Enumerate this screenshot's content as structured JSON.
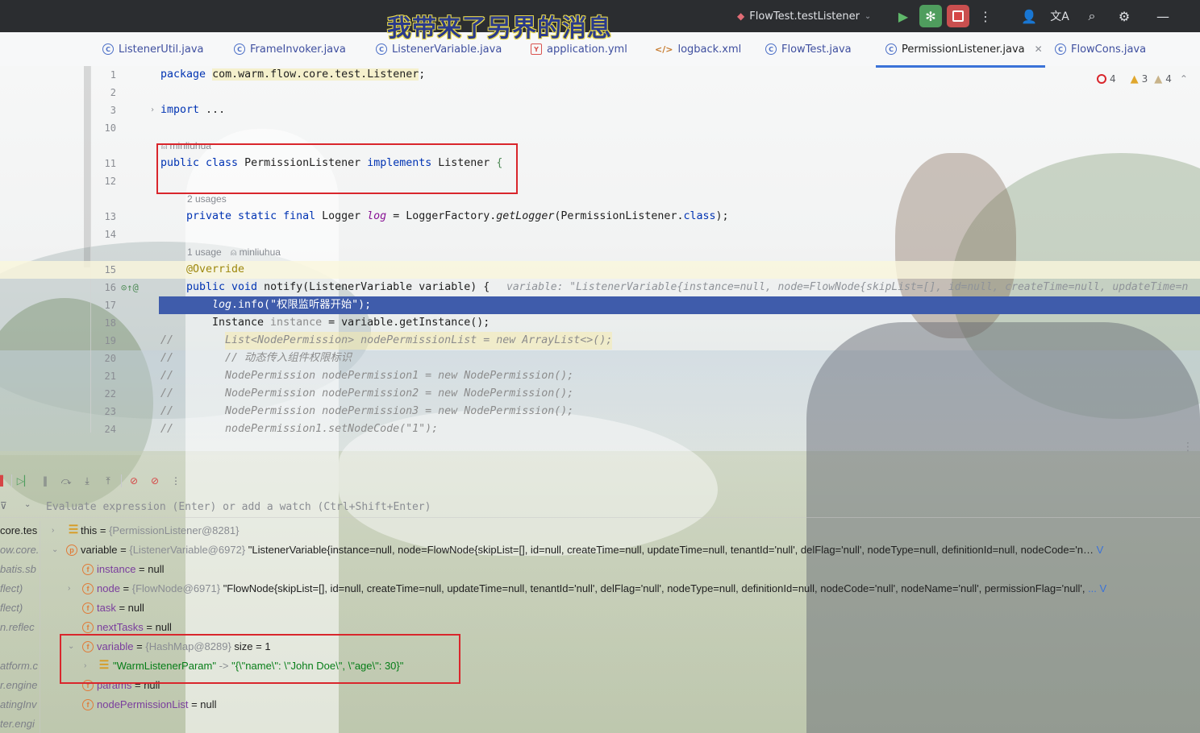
{
  "overlay_caption": "我带来了另界的消息",
  "titlebar": {
    "run_config": "FlowTest.testListener"
  },
  "tabs": [
    {
      "label": "ListenerUtil.java",
      "icon": "java-class-icon"
    },
    {
      "label": "FrameInvoker.java",
      "icon": "java-class-icon"
    },
    {
      "label": "ListenerVariable.java",
      "icon": "java-class-icon"
    },
    {
      "label": "application.yml",
      "icon": "yaml-file-icon"
    },
    {
      "label": "logback.xml",
      "icon": "xml-file-icon"
    },
    {
      "label": "FlowTest.java",
      "icon": "java-class-icon"
    },
    {
      "label": "PermissionListener.java",
      "icon": "java-class-icon",
      "active": true
    },
    {
      "label": "FlowCons.java",
      "icon": "java-class-icon"
    }
  ],
  "problems": {
    "errors": "4",
    "warnings": "3",
    "weak_warnings": "4"
  },
  "editor": {
    "line_numbers": [
      "1",
      "2",
      "3",
      "10",
      "11",
      "12",
      "13",
      "14",
      "15",
      "16",
      "17",
      "18",
      "19",
      "20",
      "21",
      "22",
      "23",
      "24"
    ],
    "package_kw": "package",
    "package_name": "com.warm.flow.core.test.Listener",
    "semicolon": ";",
    "import_kw": "import",
    "import_rest": " ...",
    "author_hint": "minliuhua",
    "class_line": {
      "mods": "public class",
      "name": " PermissionListener ",
      "impl": "implements",
      "iface": " Listener ",
      "brace": "{"
    },
    "usages_2": "2 usages",
    "logger_line": {
      "mods": "private static final",
      "type": " Logger ",
      "field": "log",
      "rest1": " = LoggerFactory.",
      "method": "getLogger",
      "rest2": "(PermissionListener.",
      "kw_class": "class",
      "rest3": ");"
    },
    "usages_1": "1 usage",
    "usages_1_author": "minliuhua",
    "override": "@Override",
    "notify_line": {
      "mods": "public void",
      "rest": " notify(ListenerVariable variable) {"
    },
    "inlay_hint": "variable: \"ListenerVariable{instance=null, node=FlowNode{skipList=[], id=null, createTime=null, updateTime=n",
    "log_line": {
      "field": "log",
      "rest1": ".info(",
      "str": "\"权限监听器开始\"",
      "rest2": ");"
    },
    "instance_line": {
      "type": "Instance",
      "name": " instance",
      "rest": " = variable.getInstance();"
    },
    "c19_slash": "//",
    "c19": "List<NodePermission> nodePermissionList = new ArrayList<>();",
    "c20_slash": "//",
    "c20": "// 动态传入组件权限标识",
    "c21_slash": "//",
    "c21": "NodePermission nodePermission1 = new NodePermission();",
    "c22_slash": "//",
    "c22": "NodePermission nodePermission2 = new NodePermission();",
    "c23_slash": "//",
    "c23": "NodePermission nodePermission3 = new NodePermission();",
    "c24_slash": "//",
    "c24": "nodePermission1.setNodeCode(\"1\");"
  },
  "debugger": {
    "eval_placeholder": "Evaluate expression (Enter) or add a watch (Ctrl+Shift+Enter)",
    "frames": [
      "core.tes",
      "ow.core.",
      "batis.sb",
      "flect)",
      "flect)",
      "n.reflec",
      "",
      "atform.c",
      "r.engine",
      "atingInv",
      "ter.engi"
    ],
    "variables": [
      {
        "name": "this",
        "eq": " = ",
        "ref": "{PermissionListener@8281}",
        "value": ""
      },
      {
        "name": "variable",
        "eq": " = ",
        "ref": "{ListenerVariable@6972}",
        "value": " \"ListenerVariable{instance=null, node=FlowNode{skipList=[], id=null, createTime=null, updateTime=null, tenantId='null', delFlag='null', nodeType=null, definitionId=null, nodeCode='n…",
        "link": " V"
      },
      {
        "name": "instance",
        "eq": " = ",
        "ref": "",
        "value": "null"
      },
      {
        "name": "node",
        "eq": " = ",
        "ref": "{FlowNode@6971}",
        "value": " \"FlowNode{skipList=[], id=null, createTime=null, updateTime=null, tenantId='null', delFlag='null', nodeType=null, definitionId=null, nodeCode='null', nodeName='null', permissionFlag='null',",
        "link": " ... V"
      },
      {
        "name": "task",
        "eq": " = ",
        "ref": "",
        "value": "null"
      },
      {
        "name": "nextTasks",
        "eq": " = ",
        "ref": "",
        "value": "null"
      },
      {
        "name": "variable",
        "eq": " = ",
        "ref": "{HashMap@8289}",
        "value": "  size = 1"
      },
      {
        "key": "\"WarmListenerParam\"",
        "arrow": " -> ",
        "val": "\"{\\\"name\\\": \\\"John Doe\\\", \\\"age\\\": 30}\""
      },
      {
        "name": "params",
        "eq": " = ",
        "ref": "",
        "value": "null"
      },
      {
        "name": "nodePermissionList",
        "eq": " = ",
        "ref": "",
        "value": "null"
      }
    ]
  }
}
